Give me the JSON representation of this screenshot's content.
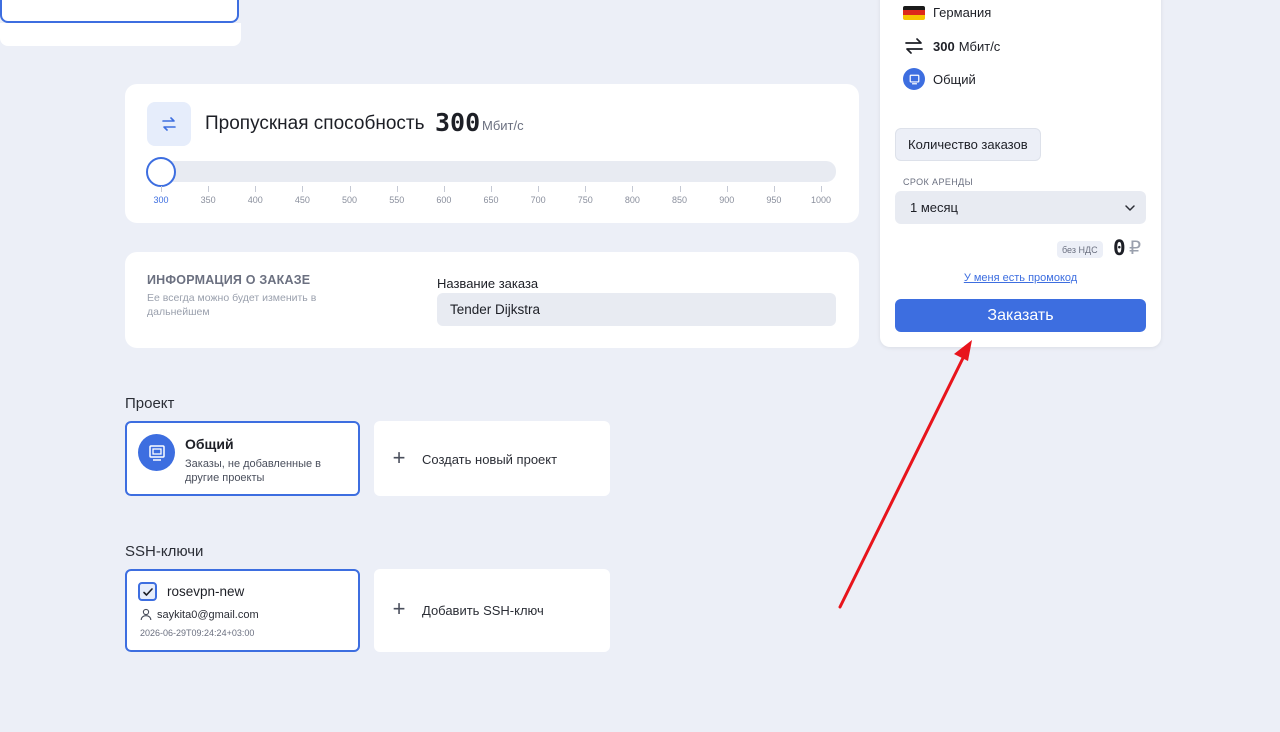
{
  "bandwidth": {
    "title": "Пропускная способность",
    "value": "300",
    "unit": "Мбит/с",
    "slider_value": 300,
    "slider_min": 300,
    "slider_max": 1000,
    "ticks": [
      "300",
      "350",
      "400",
      "450",
      "500",
      "550",
      "600",
      "650",
      "700",
      "750",
      "800",
      "850",
      "900",
      "950",
      "1000"
    ]
  },
  "order_info": {
    "title": "ИНФОРМАЦИЯ О ЗАКАЗЕ",
    "subtitle": "Ее всегда можно будет изменить в дальнейшем",
    "name_label": "Название заказа",
    "name_value": "Tender Dijkstra"
  },
  "project": {
    "heading": "Проект",
    "selected_name": "Общий",
    "selected_desc": "Заказы, не добавленные в другие проекты",
    "create_label": "Создать новый проект"
  },
  "ssh": {
    "heading": "SSH-ключи",
    "key_name": "rosevpn-new",
    "key_email": "saykita0@gmail.com",
    "key_date": "2026-06-29T09:24:24+03:00",
    "add_label": "Добавить SSH-ключ"
  },
  "sidebar": {
    "country": "Германия",
    "speed_value": "300",
    "speed_unit": "Мбит/с",
    "project": "Общий",
    "quantity_button": "Количество заказов",
    "rent_label": "СРОК АРЕНДЫ",
    "rent_value": "1 месяц",
    "vat_badge": "без НДС",
    "price": "0",
    "currency": "₽",
    "promo_link": "У меня есть промокод",
    "order_button": "Заказать"
  },
  "colors": {
    "accent": "#3d6ee0",
    "background": "#eceff7",
    "annotation_arrow": "#e8141c"
  }
}
